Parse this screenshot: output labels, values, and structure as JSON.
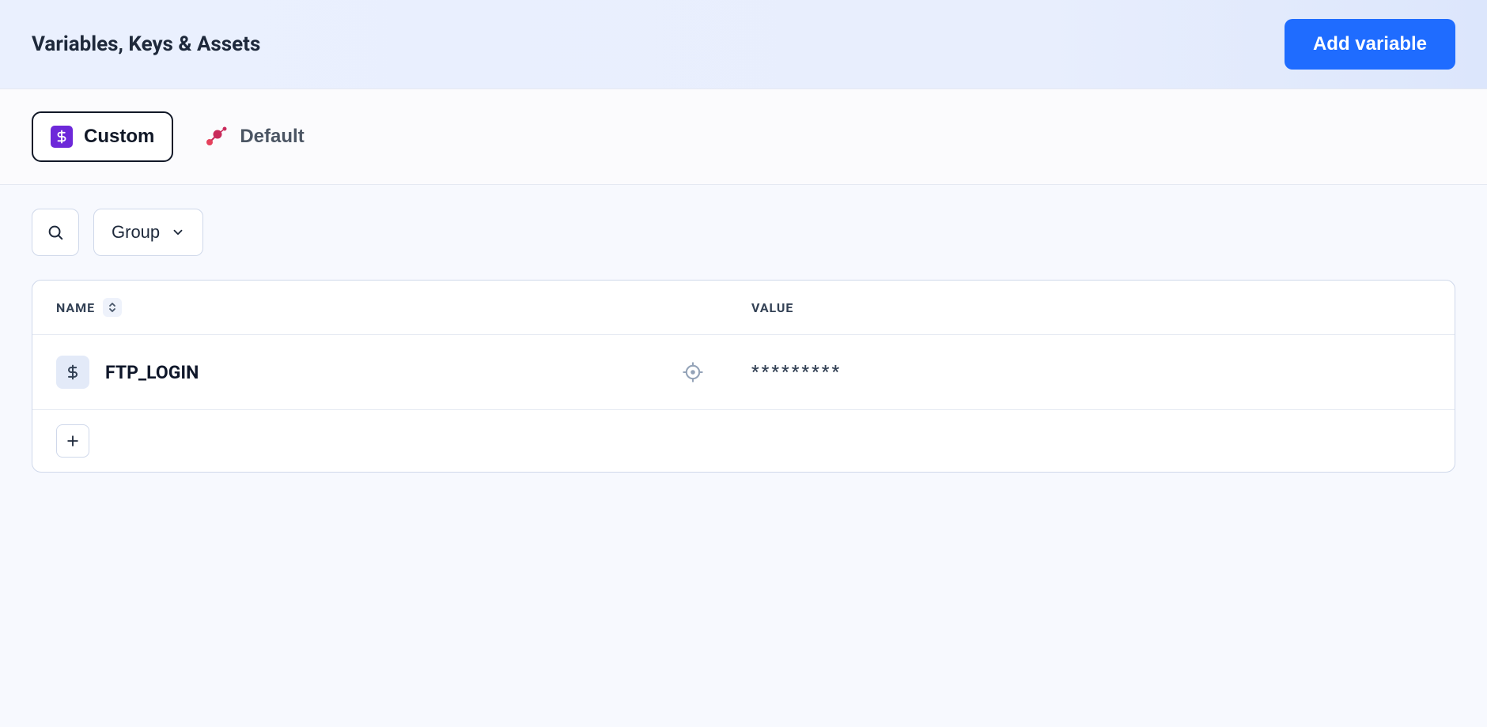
{
  "header": {
    "title": "Variables, Keys & Assets",
    "add_button_label": "Add variable"
  },
  "tabs": {
    "custom_label": "Custom",
    "default_label": "Default"
  },
  "filters": {
    "group_label": "Group"
  },
  "table": {
    "columns": {
      "name": "NAME",
      "value": "VALUE"
    },
    "rows": [
      {
        "name": "FTP_LOGIN",
        "value": "*********"
      }
    ]
  }
}
